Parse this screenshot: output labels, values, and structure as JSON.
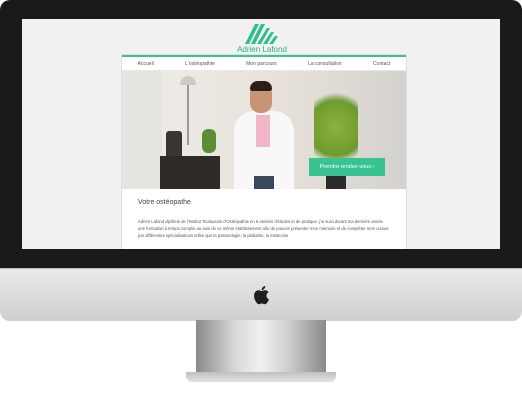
{
  "site": {
    "brand": "Adrien Lafond",
    "accent_color": "#38c391",
    "nav": [
      {
        "label": "Accueil"
      },
      {
        "label": "L'ostéopathie"
      },
      {
        "label": "Mon parcours"
      },
      {
        "label": "La consultation"
      },
      {
        "label": "Contact"
      }
    ],
    "cta_label": "Prendre rendez-vous ›",
    "section_title": "Votre ostéopathe",
    "paragraph": "Adrien Lafond diplômé de l'Institut Toulousain d'Ostéopathie en 6 années d'études et de pratique, j'ai suivi durant ma dernière année une formation à temps complet au sein de ce même établissement afin de pouvoir présenter mon mémoire et de compléter mon cursus par différentes spécialisations telles que la posturologie, la pédiatrie, la médecine"
  },
  "icons": {
    "logo": "mountain-stripes-logo",
    "apple": "apple-logo-icon"
  }
}
